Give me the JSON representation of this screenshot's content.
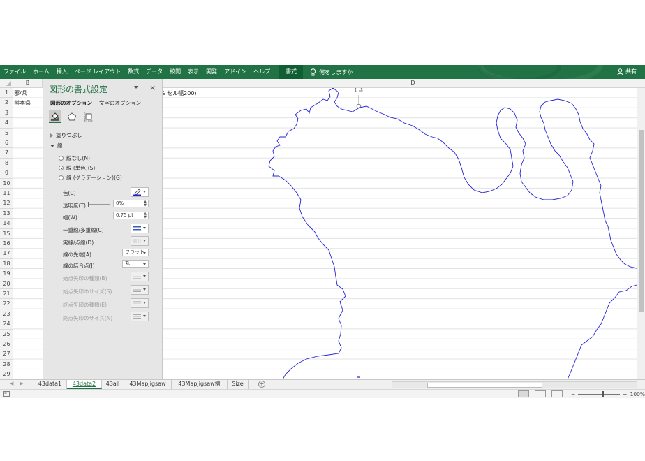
{
  "ribbon": {
    "tabs": [
      "ファイル",
      "ホーム",
      "挿入",
      "ページ レイアウト",
      "数式",
      "データ",
      "校閲",
      "表示",
      "開発",
      "アドイン",
      "ヘルプ",
      "書式"
    ],
    "active_tab": "書式",
    "tell_me": "何をしますか",
    "share": "共有",
    "accent_color": "#217346"
  },
  "columns": [
    "B",
    "D"
  ],
  "rows": [
    "1",
    "2",
    "3",
    "4",
    "5",
    "6",
    "7",
    "8",
    "9",
    "10",
    "11",
    "12",
    "13",
    "14",
    "15",
    "16",
    "17",
    "18",
    "19",
    "20",
    "21",
    "22",
    "23",
    "24",
    "25",
    "26",
    "27",
    "28",
    "29"
  ],
  "cells": {
    "b1": "郡/県",
    "b2": "熊本県",
    "c1_tail": "% セル幅200)"
  },
  "panel": {
    "title": "図形の書式設定",
    "close": "×",
    "tab_shape": "図形のオプション",
    "tab_text": "文字のオプション",
    "section_fill": "塗りつぶし",
    "section_line": "線",
    "radio_none": "線なし(N)",
    "radio_solid": "線 (単色)(S)",
    "radio_gradient": "線 (グラデーション)(G)",
    "color_label": "色(C)",
    "transparency_label": "透明度(T)",
    "transparency_value": "0%",
    "width_label": "幅(W)",
    "width_value": "0.75 pt",
    "compound_label": "一重線/多重線(C)",
    "dash_label": "実線/点線(D)",
    "cap_label": "線の先端(A)",
    "cap_value": "フラット",
    "join_label": "線の結合点(J)",
    "join_value": "丸",
    "begin_arrow_type": "始点矢印の種類(B)",
    "begin_arrow_size": "始点矢印のサイズ(S)",
    "end_arrow_type": "終点矢印の種類(E)",
    "end_arrow_size": "終点矢印のサイズ(N)",
    "line_color": "#2222dd"
  },
  "sheets": [
    "43data1",
    "43data2",
    "43all",
    "43MapJigsaw",
    "43MapJigsaw例",
    "Size"
  ],
  "active_sheet": "43data2",
  "status": {
    "zoom": "100%"
  }
}
